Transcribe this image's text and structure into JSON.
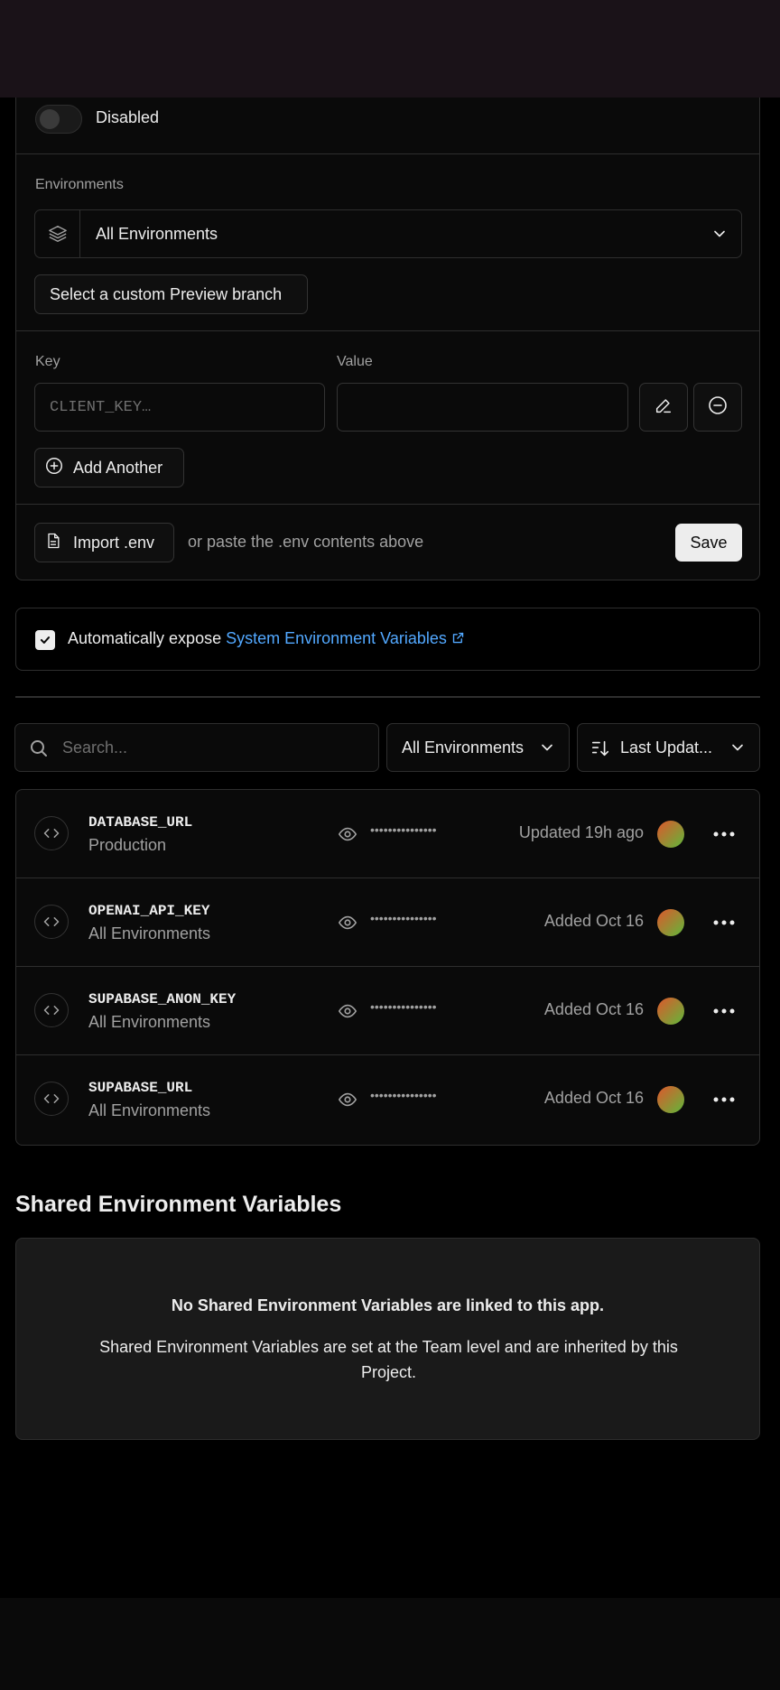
{
  "form": {
    "toggle_label": "Disabled",
    "environments_label": "Environments",
    "environment_selected": "All Environments",
    "preview_branch_button": "Select a custom Preview branch",
    "key_label": "Key",
    "value_label": "Value",
    "key_placeholder": "CLIENT_KEY…",
    "value_placeholder": "",
    "add_another": "Add Another",
    "import_button": "Import .env",
    "paste_hint": "or paste the .env contents above",
    "save_button": "Save"
  },
  "expose": {
    "checked": true,
    "text": "Automatically expose",
    "link": "System Environment Variables"
  },
  "filters": {
    "search_placeholder": "Search...",
    "environment_filter": "All Environments",
    "sort": "Last Updat..."
  },
  "variables": [
    {
      "name": "DATABASE_URL",
      "environment": "Production",
      "value_masked": "•••••••••••••••",
      "updated": "Updated 19h ago"
    },
    {
      "name": "OPENAI_API_KEY",
      "environment": "All Environments",
      "value_masked": "•••••••••••••••",
      "updated": "Added Oct 16"
    },
    {
      "name": "SUPABASE_ANON_KEY",
      "environment": "All Environments",
      "value_masked": "•••••••••••••••",
      "updated": "Added Oct 16"
    },
    {
      "name": "SUPABASE_URL",
      "environment": "All Environments",
      "value_masked": "•••••••••••••••",
      "updated": "Added Oct 16"
    }
  ],
  "shared": {
    "title": "Shared Environment Variables",
    "empty_heading": "No Shared Environment Variables are linked to this app.",
    "empty_body": "Shared Environment Variables are set at the Team level and are inherited by this Project."
  },
  "colors": {
    "background": "#000000",
    "panel": "#0a0a0a",
    "border": "#2e2e2e",
    "link": "#52a8ff",
    "muted_text": "#a1a1a1",
    "top_bar": "#1a1218"
  }
}
